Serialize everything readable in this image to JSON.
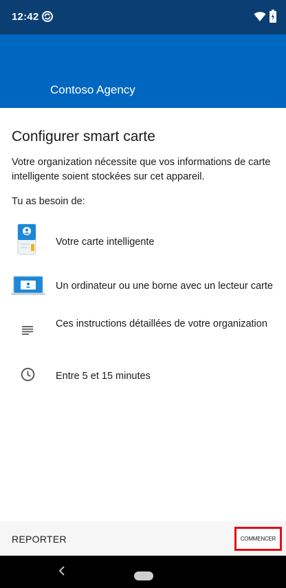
{
  "status_bar": {
    "time": "12:42",
    "icons": [
      "sync-icon",
      "wifi-icon",
      "battery-icon"
    ]
  },
  "header": {
    "title": "Contoso Agency",
    "background_color": "#0067c0"
  },
  "content": {
    "title": "Configurer smart carte",
    "intro": "Votre organization nécessite que vos informations de carte intelligente soient stockées sur cet appareil.",
    "need_label": "Tu as besoin de:",
    "requirements": [
      {
        "icon": "smart-card-icon",
        "label": "Votre carte intelligente"
      },
      {
        "icon": "laptop-card-reader-icon",
        "label": "Un ordinateur ou une borne avec un lecteur carte"
      },
      {
        "icon": "document-lines-icon",
        "label": "Ces instructions détaillées de votre organization"
      },
      {
        "icon": "clock-icon",
        "label": "Entre 5 et 15 minutes"
      }
    ]
  },
  "actions": {
    "later_label": "REPORTER",
    "start_label": "COMMENCER",
    "highlight_color": "#e0101a"
  },
  "nav_bar": {
    "icons": [
      "back-icon",
      "home-pill-icon"
    ]
  }
}
